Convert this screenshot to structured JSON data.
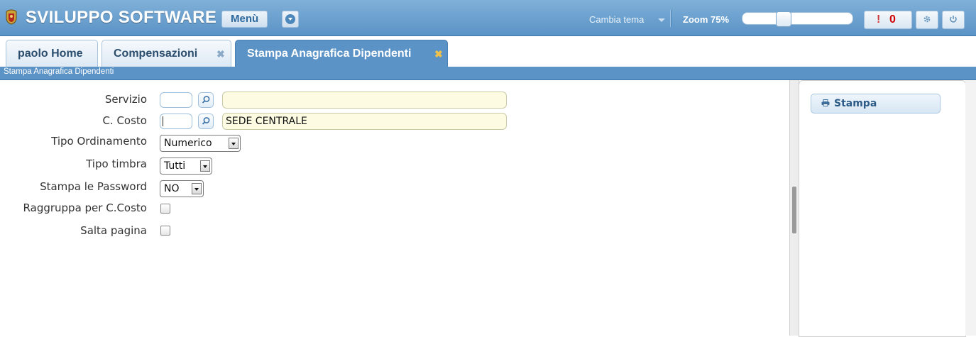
{
  "topbar": {
    "app_title": "SVILUPPO SOFTWARE",
    "menu_label": "Menù",
    "theme_label": "Cambia tema",
    "zoom_label": "Zoom 75%",
    "zoom_value": 0.35,
    "notification_bang": "!",
    "notification_count": "0",
    "icons": [
      "logo-crest-icon",
      "chevron-down-icon",
      "caret-down-icon",
      "gear-icon",
      "power-icon"
    ]
  },
  "tabs": [
    {
      "label": "paolo Home",
      "closable": false,
      "active": false
    },
    {
      "label": "Compensazioni",
      "closable": true,
      "active": false
    },
    {
      "label": "Stampa Anagrafica Dipendenti",
      "closable": true,
      "active": true
    }
  ],
  "tab_close_glyph": "✖",
  "breadcrumb": "Stampa Anagrafica Dipendenti",
  "form": {
    "servizio": {
      "label": "Servizio",
      "code": "",
      "description": ""
    },
    "c_costo": {
      "label": "C. Costo",
      "code": "",
      "description": "SEDE CENTRALE"
    },
    "tipo_ordinamento": {
      "label": "Tipo Ordinamento",
      "value": "Numerico"
    },
    "tipo_timbra": {
      "label": "Tipo timbra",
      "value": "Tutti"
    },
    "stampa_password": {
      "label": "Stampa le Password",
      "value": "NO"
    },
    "raggruppa": {
      "label": "Raggruppa per C.Costo",
      "checked": false
    },
    "salta_pagina": {
      "label": "Salta pagina",
      "checked": false
    }
  },
  "side_panel": {
    "stampa_label": "Stampa",
    "icon": "printer-icon"
  },
  "colors": {
    "header_blue": "#5b93c6",
    "notification_red": "#d00000",
    "readonly_field": "#fdfce3",
    "close_active": "#f0c24a"
  }
}
